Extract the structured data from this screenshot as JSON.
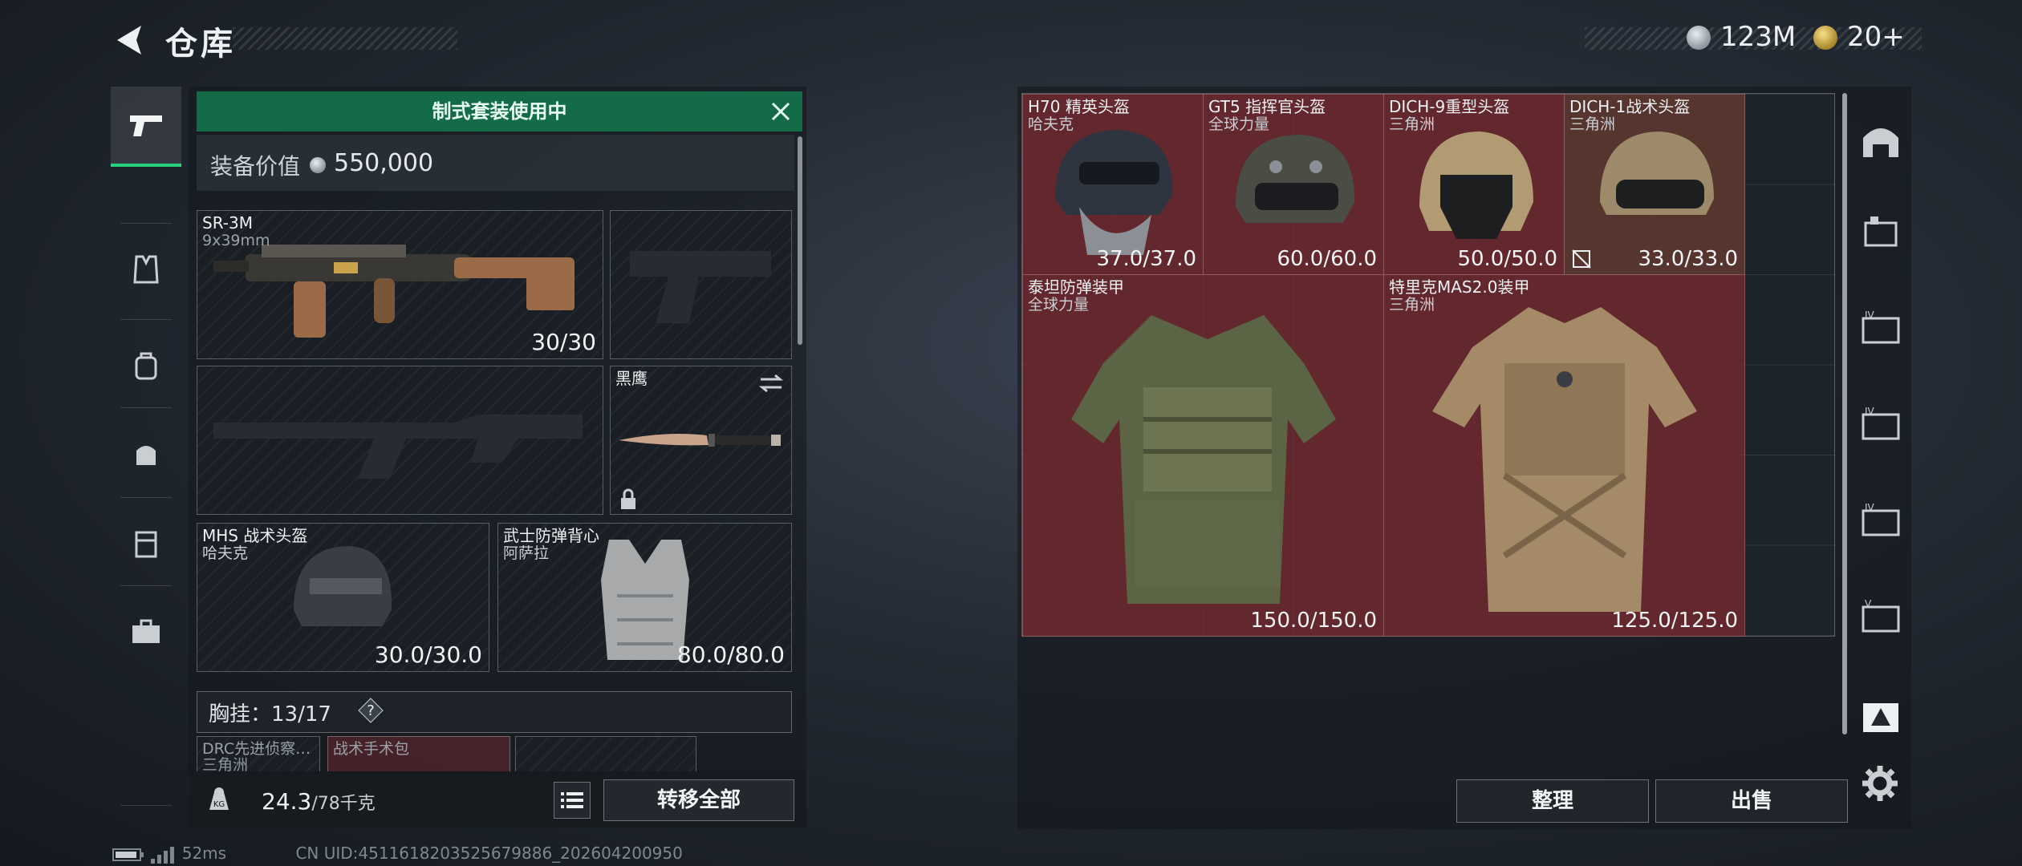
{
  "header": {
    "title": "仓库",
    "currency1": "123M",
    "currency2": "20+"
  },
  "loadout": {
    "banner": "制式套装使用中",
    "value_label": "装备价值",
    "value": "550,000",
    "primary": {
      "name": "SR-3M",
      "ammo": "9x39mm",
      "value": "30/30"
    },
    "melee": {
      "name": "黑鹰"
    },
    "helmet": {
      "name": "MHS 战术头盔",
      "maker": "哈夫克",
      "value": "30.0/30.0"
    },
    "armor": {
      "name": "武士防弹背心",
      "maker": "阿萨拉",
      "value": "80.0/80.0"
    },
    "chest_label": "胸挂：",
    "chest_value": "13/17",
    "chest_items": [
      {
        "name": "DRC先进侦察…",
        "maker": "三角洲"
      },
      {
        "name": "战术手术包",
        "maker": ""
      }
    ],
    "weight": "24.3",
    "weight_unit": "/78千克",
    "transfer_label": "转移全部"
  },
  "status": {
    "ping": "52ms",
    "uid": "CN UID:4511618203525679886_202604200950"
  },
  "storage": {
    "items": [
      {
        "name": "H70 精英头盔",
        "maker": "哈夫克",
        "value": "37.0/37.0"
      },
      {
        "name": "GT5 指挥官头盔",
        "maker": "全球力量",
        "value": "60.0/60.0"
      },
      {
        "name": "DICH-9重型头盔",
        "maker": "三角洲",
        "value": "50.0/50.0"
      },
      {
        "name": "DICH-1战术头盔",
        "maker": "三角洲",
        "value": "33.0/33.0"
      },
      {
        "name": "泰坦防弹装甲",
        "maker": "全球力量",
        "value": "150.0/150.0"
      },
      {
        "name": "特里克MAS2.0装甲",
        "maker": "三角洲",
        "value": "125.0/125.0"
      }
    ],
    "sort_label": "整理",
    "sell_label": "出售"
  },
  "right_tabs": [
    "IV",
    "IV",
    "IV",
    "V"
  ]
}
